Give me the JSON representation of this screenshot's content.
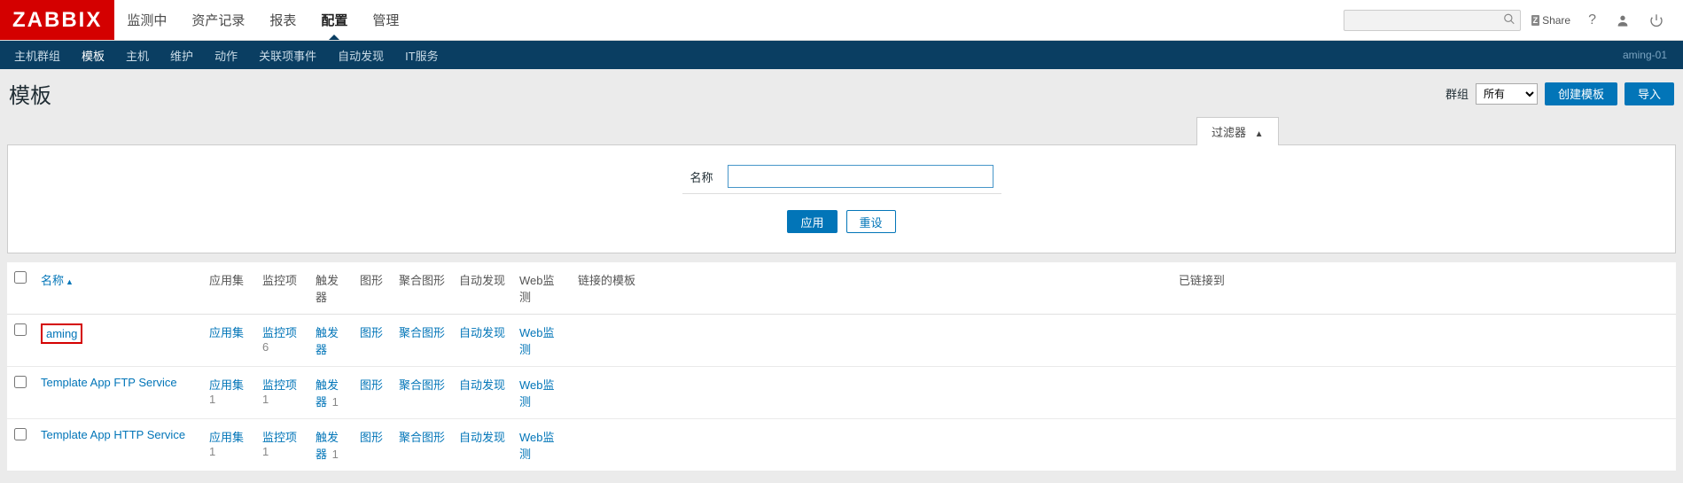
{
  "logo": "ZABBIX",
  "topnav": {
    "monitoring": "监测中",
    "inventory": "资产记录",
    "reports": "报表",
    "configuration": "配置",
    "admin": "管理"
  },
  "share_label": "Share",
  "subnav": {
    "hostgroups": "主机群组",
    "templates": "模板",
    "hosts": "主机",
    "maintenance": "维护",
    "actions": "动作",
    "correlation": "关联项事件",
    "discovery": "自动发现",
    "it_services": "IT服务"
  },
  "current_user": "aming-01",
  "page_title": "模板",
  "group_label": "群组",
  "group_value": "所有",
  "btn_create": "创建模板",
  "btn_import": "导入",
  "filter_tab": "过滤器",
  "filter_name_label": "名称",
  "filter_name_value": "",
  "btn_apply": "应用",
  "btn_reset": "重设",
  "columns": {
    "name": "名称",
    "applications": "应用集",
    "items": "监控项",
    "triggers": "触发器",
    "graphs": "图形",
    "screens": "聚合图形",
    "discovery": "自动发现",
    "web": "Web监测",
    "linked_templates": "链接的模板",
    "linked_to": "已链接到"
  },
  "rows": [
    {
      "name": "aming",
      "highlighted": true,
      "apps": "应用集",
      "apps_n": "",
      "items": "监控项",
      "items_n": "6",
      "triggers": "触发器",
      "triggers_n": "",
      "graphs": "图形",
      "screens": "聚合图形",
      "discovery": "自动发现",
      "web": "Web监测"
    },
    {
      "name": "Template App FTP Service",
      "highlighted": false,
      "apps": "应用集",
      "apps_n": "1",
      "items": "监控项",
      "items_n": "1",
      "triggers": "触发器",
      "triggers_n": "1",
      "graphs": "图形",
      "screens": "聚合图形",
      "discovery": "自动发现",
      "web": "Web监测"
    },
    {
      "name": "Template App HTTP Service",
      "highlighted": false,
      "apps": "应用集",
      "apps_n": "1",
      "items": "监控项",
      "items_n": "1",
      "triggers": "触发器",
      "triggers_n": "1",
      "graphs": "图形",
      "screens": "聚合图形",
      "discovery": "自动发现",
      "web": "Web监测"
    }
  ]
}
